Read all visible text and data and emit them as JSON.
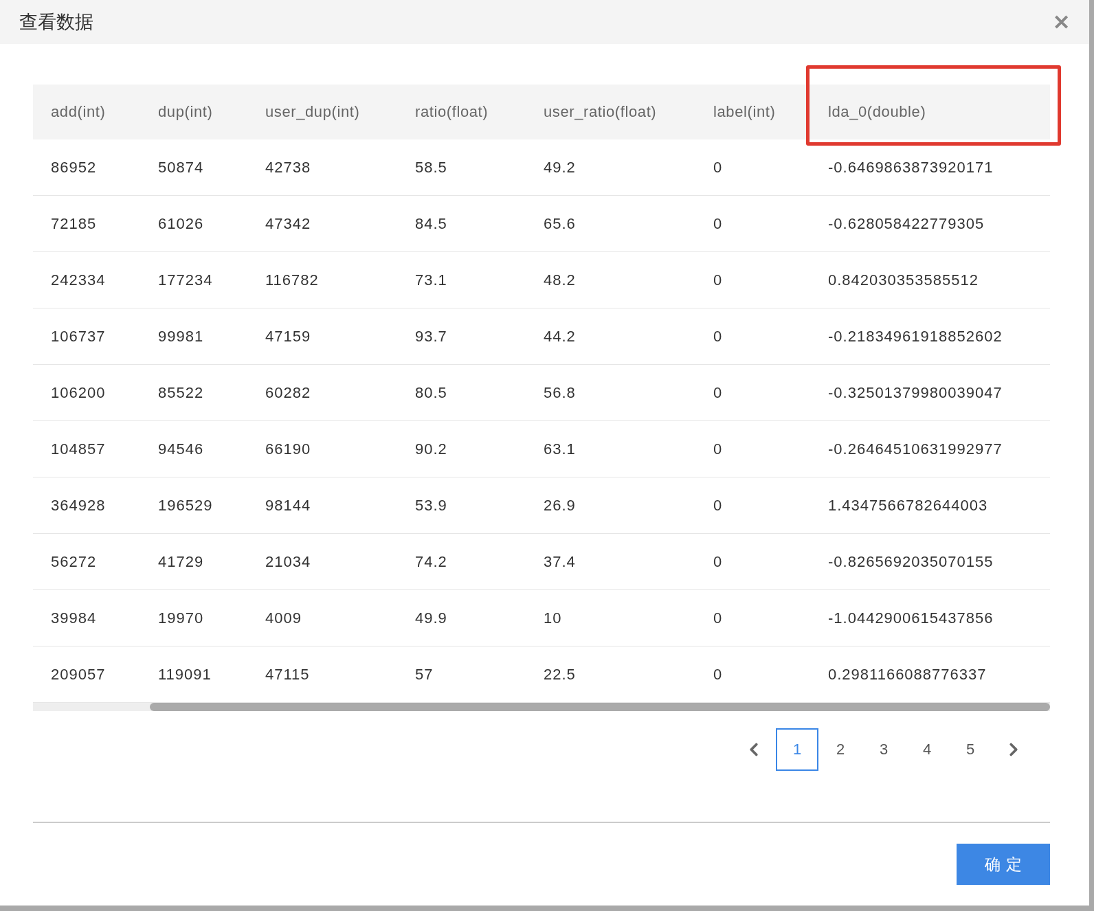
{
  "dialog": {
    "title": "查看数据",
    "close": "✕"
  },
  "table": {
    "columns": [
      {
        "label": "add(int)",
        "highlighted": false
      },
      {
        "label": "dup(int)",
        "highlighted": false
      },
      {
        "label": "user_dup(int)",
        "highlighted": false
      },
      {
        "label": "ratio(float)",
        "highlighted": false
      },
      {
        "label": "user_ratio(float)",
        "highlighted": false
      },
      {
        "label": "label(int)",
        "highlighted": false
      },
      {
        "label": "lda_0(double)",
        "highlighted": true
      }
    ],
    "rows": [
      [
        "86952",
        "50874",
        "42738",
        "58.5",
        "49.2",
        "0",
        "-0.6469863873920171"
      ],
      [
        "72185",
        "61026",
        "47342",
        "84.5",
        "65.6",
        "0",
        "-0.628058422779305"
      ],
      [
        "242334",
        "177234",
        "116782",
        "73.1",
        "48.2",
        "0",
        "0.842030353585512"
      ],
      [
        "106737",
        "99981",
        "47159",
        "93.7",
        "44.2",
        "0",
        "-0.21834961918852602"
      ],
      [
        "106200",
        "85522",
        "60282",
        "80.5",
        "56.8",
        "0",
        "-0.32501379980039047"
      ],
      [
        "104857",
        "94546",
        "66190",
        "90.2",
        "63.1",
        "0",
        "-0.26464510631992977"
      ],
      [
        "364928",
        "196529",
        "98144",
        "53.9",
        "26.9",
        "0",
        "1.4347566782644003"
      ],
      [
        "56272",
        "41729",
        "21034",
        "74.2",
        "37.4",
        "0",
        "-0.8265692035070155"
      ],
      [
        "39984",
        "19970",
        "4009",
        "49.9",
        "10",
        "0",
        "-1.0442900615437856"
      ],
      [
        "209057",
        "119091",
        "47115",
        "57",
        "22.5",
        "0",
        "0.2981166088776337"
      ]
    ]
  },
  "pagination": {
    "pages": [
      {
        "label": "1",
        "selected": true
      },
      {
        "label": "2",
        "selected": false
      },
      {
        "label": "3",
        "selected": false
      },
      {
        "label": "4",
        "selected": false
      },
      {
        "label": "5",
        "selected": false
      }
    ]
  },
  "footer": {
    "confirm": "确 定"
  }
}
